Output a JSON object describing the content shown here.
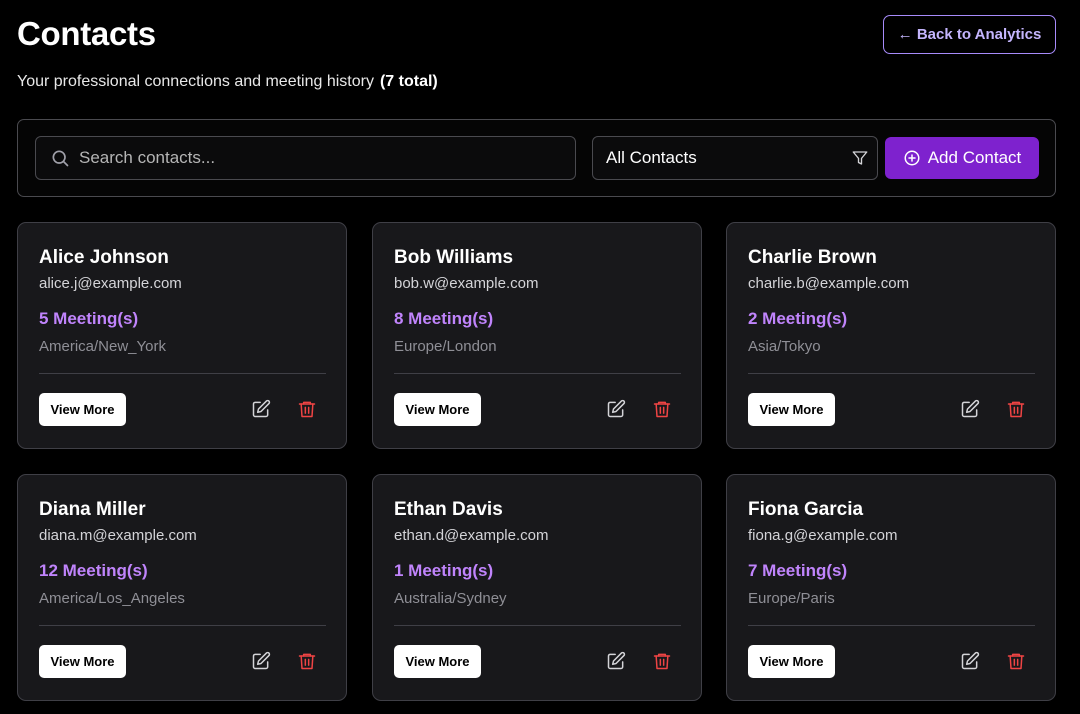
{
  "header": {
    "title": "Contacts",
    "subtitle": "Your professional connections and meeting history",
    "total": "(7 total)",
    "back_label": "← Back to Analytics"
  },
  "toolbar": {
    "search_placeholder": "Search contacts...",
    "filter_value": "All Contacts",
    "add_label": "Add Contact"
  },
  "icons": {
    "search": "search-icon",
    "filter": "filter-icon",
    "add": "plus-circle-icon",
    "edit": "edit-icon",
    "delete": "trash-icon"
  },
  "colors": {
    "accent": "#7e22ce",
    "accent_light": "#c084fc",
    "back_border": "#a78bfa",
    "danger": "#ef4444",
    "card_bg": "#18181b"
  },
  "contacts": [
    {
      "name": "Alice Johnson",
      "email": "alice.j@example.com",
      "meetings": "5 Meeting(s)",
      "timezone": "America/New_York",
      "view_label": "View More"
    },
    {
      "name": "Bob Williams",
      "email": "bob.w@example.com",
      "meetings": "8 Meeting(s)",
      "timezone": "Europe/London",
      "view_label": "View More"
    },
    {
      "name": "Charlie Brown",
      "email": "charlie.b@example.com",
      "meetings": "2 Meeting(s)",
      "timezone": "Asia/Tokyo",
      "view_label": "View More"
    },
    {
      "name": "Diana Miller",
      "email": "diana.m@example.com",
      "meetings": "12 Meeting(s)",
      "timezone": "America/Los_Angeles",
      "view_label": "View More"
    },
    {
      "name": "Ethan Davis",
      "email": "ethan.d@example.com",
      "meetings": "1 Meeting(s)",
      "timezone": "Australia/Sydney",
      "view_label": "View More"
    },
    {
      "name": "Fiona Garcia",
      "email": "fiona.g@example.com",
      "meetings": "7 Meeting(s)",
      "timezone": "Europe/Paris",
      "view_label": "View More"
    }
  ]
}
